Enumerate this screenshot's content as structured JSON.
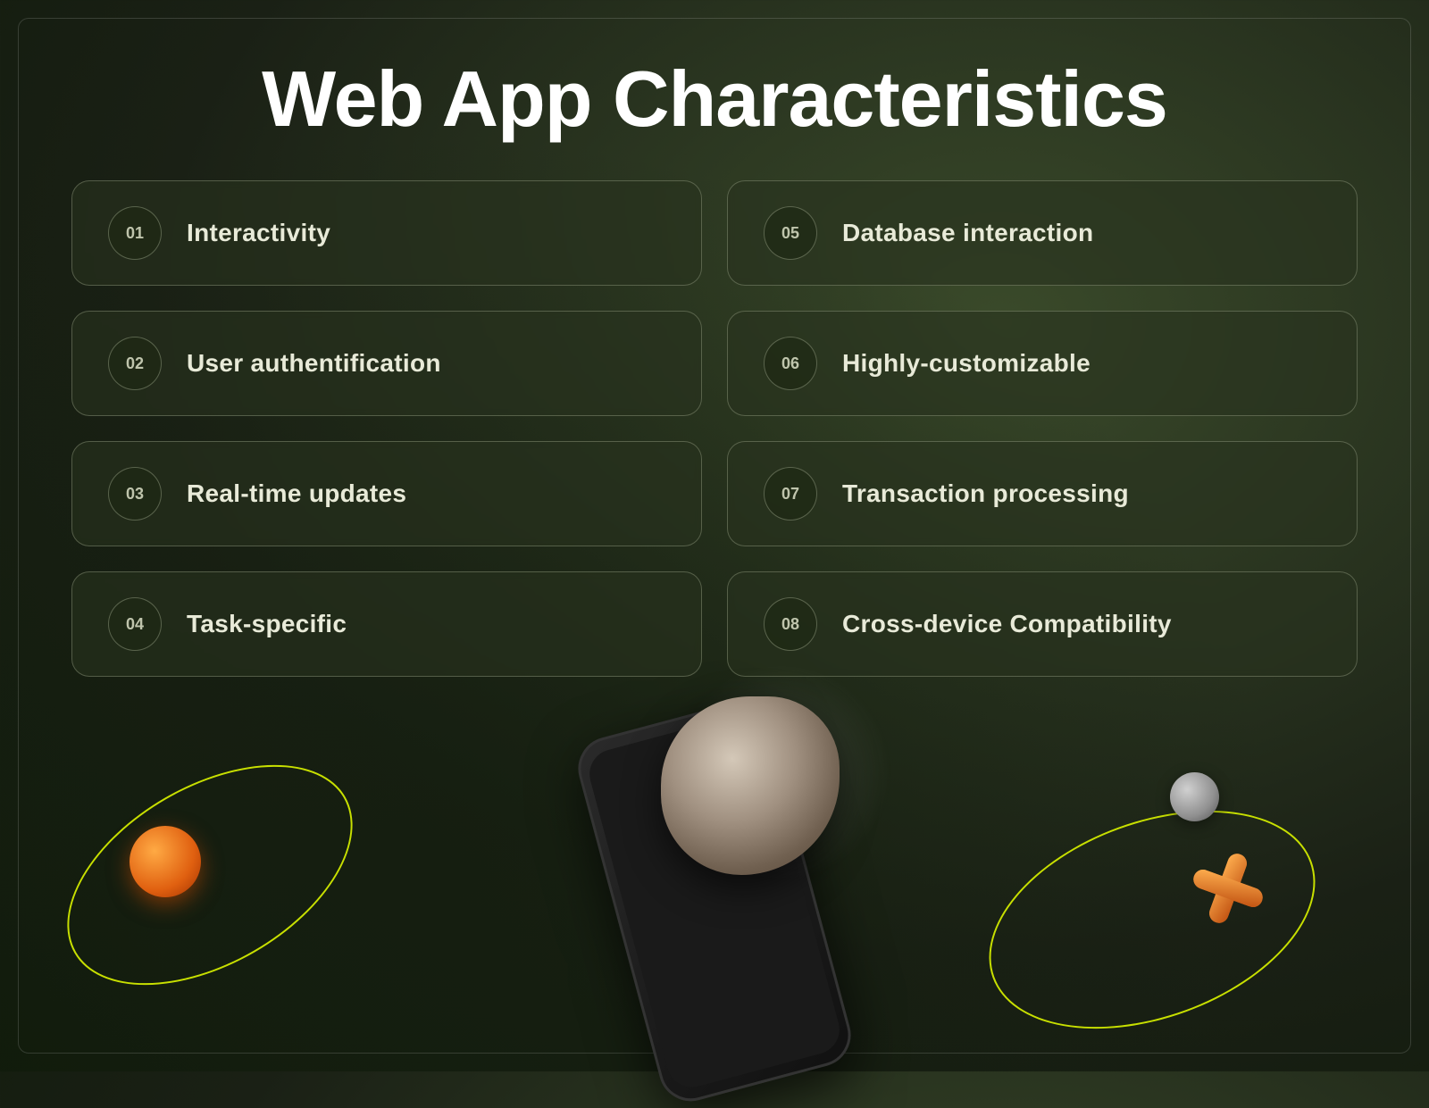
{
  "page": {
    "title": "Web App Characteristics",
    "cards": [
      {
        "number": "01",
        "label": "Interactivity"
      },
      {
        "number": "05",
        "label": "Database interaction"
      },
      {
        "number": "02",
        "label": "User authentification"
      },
      {
        "number": "06",
        "label": "Highly-customizable"
      },
      {
        "number": "03",
        "label": "Real-time updates"
      },
      {
        "number": "07",
        "label": "Transaction processing"
      },
      {
        "number": "04",
        "label": "Task-specific"
      },
      {
        "number": "08",
        "label": "Cross-device Compatibility"
      }
    ]
  },
  "colors": {
    "background_dark": "#1a2015",
    "card_bg": "rgba(40,50,30,0.6)",
    "text_primary": "#ffffff",
    "text_label": "#e8ead8",
    "text_number": "rgba(220,225,200,0.85)",
    "accent_yellow": "#c8e000",
    "accent_orange": "#e06010"
  }
}
